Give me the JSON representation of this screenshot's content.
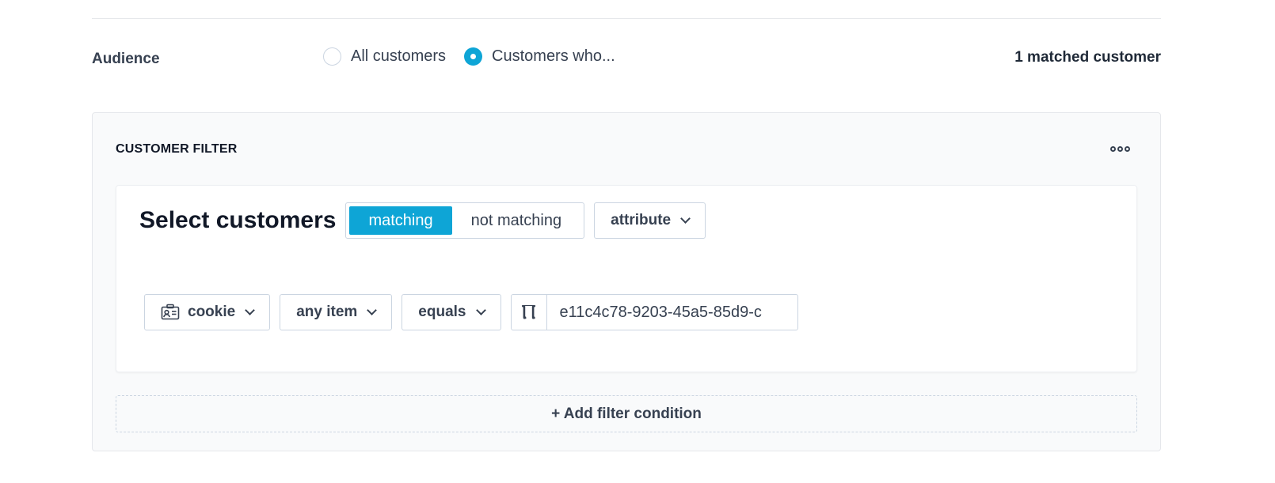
{
  "audience": {
    "label": "Audience",
    "options": [
      {
        "label": "All customers",
        "selected": false
      },
      {
        "label": "Customers who...",
        "selected": true
      }
    ],
    "matched_count": "1 matched customer"
  },
  "filter_panel": {
    "title": "CUSTOMER FILTER",
    "more_icon": "more-horizontal-icon",
    "select_heading": "Select customers",
    "match_toggle": {
      "options": [
        "matching",
        "not matching"
      ],
      "selected": "matching"
    },
    "condition_type": "attribute",
    "condition": {
      "attribute_icon": "contact-card-icon",
      "attribute": "cookie",
      "scope": "any item",
      "operator": "equals",
      "value_type_icon": "text-type-icon",
      "value_type_glyph": "Ⲡ",
      "value": "e11c4c78-9203-45a5-85d9-c"
    },
    "add_condition_label": "+ Add filter condition"
  },
  "colors": {
    "accent": "#0ea5d6",
    "border": "#cbd5e1",
    "panel_bg": "#f9fafb"
  }
}
